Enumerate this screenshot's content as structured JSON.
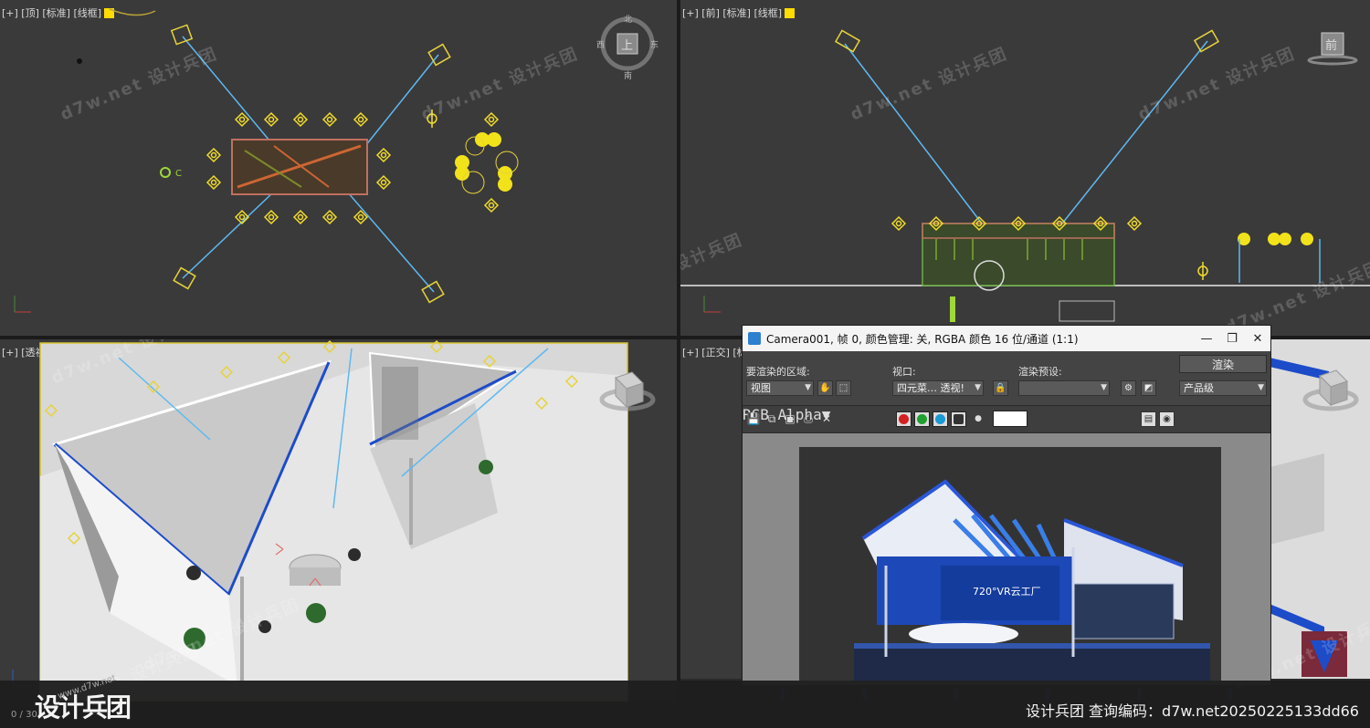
{
  "viewports": {
    "top_label": "[+] [顶] [标准] [线框]",
    "front_label": "[+] [前] [标准] [线框]",
    "persp_label": "[+] [透视] [标准] [默认明暗处理]",
    "ortho_label": "[+] [正交] [标准] [默认明暗处理]",
    "viewcube_top": "上",
    "viewcube_front": "前",
    "compass": {
      "n": "北",
      "w": "西",
      "e": "东",
      "s": "南"
    }
  },
  "watermark": "d7w.net 设计兵团",
  "render_window": {
    "title": "Camera001, 帧 0, 颜色管理: 关, RGBA 颜色 16 位/通道 (1:1)",
    "area_label": "要渲染的区域:",
    "area_value": "视图",
    "viewport_label": "视口:",
    "viewport_value": "四元菜… 透视!",
    "preset_label": "渲染预设:",
    "preset_value": "",
    "render_button": "渲染",
    "quality_value": "产品级",
    "channel_value": "RGB Alpha",
    "booth_sign": "720°VR云工厂"
  },
  "footer": {
    "text": "设计兵团  查询编码：d7w.net20250225133dd66",
    "logo": "设计兵团",
    "frame": "0 / 30",
    "site": "www.d7w.net"
  },
  "colors": {
    "viewport_bg": "#3a3a3a",
    "accent_yellow": "#ffdd00",
    "light_blue": "#5fb8f0",
    "booth_blue": "#1d4cc9"
  }
}
